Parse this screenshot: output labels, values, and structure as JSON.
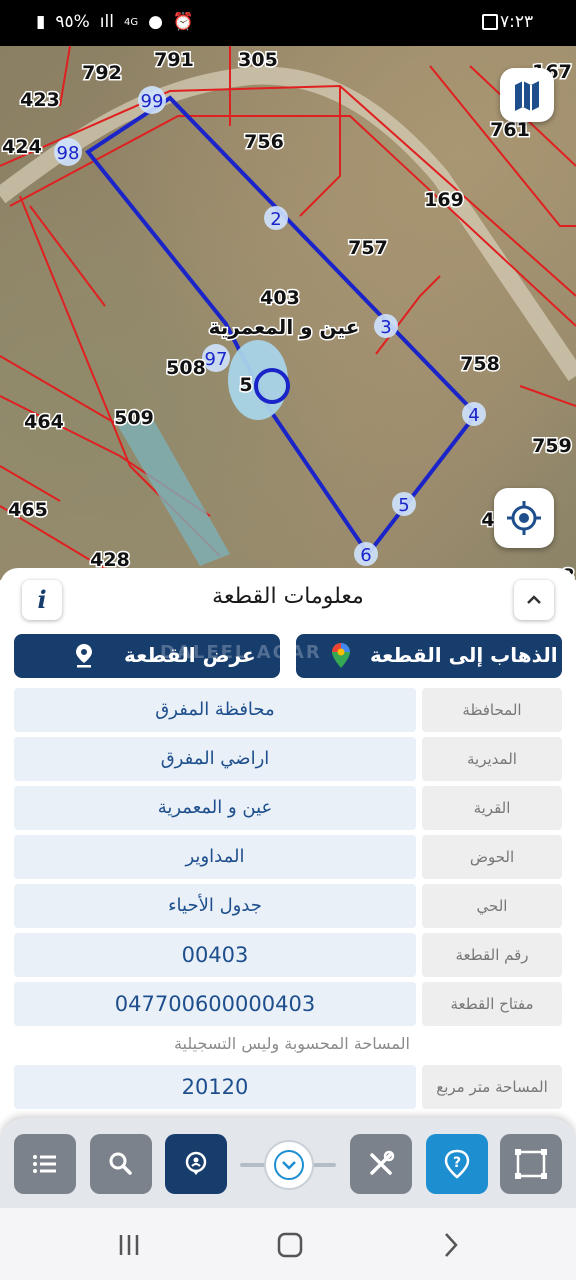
{
  "status_bar": {
    "time": "٧:٢٣",
    "battery": "٩٥%",
    "network": "4G",
    "icons": [
      "battery-icon",
      "signal-icon",
      "network-4g-icon",
      "location-icon",
      "alarm-icon",
      "notification-square-icon"
    ]
  },
  "map": {
    "parcel_numbers": [
      "791",
      "305",
      "792",
      "167",
      "423",
      "99",
      "424",
      "98",
      "756",
      "761",
      "169",
      "757",
      "403",
      "758",
      "508",
      "509",
      "464",
      "759",
      "465",
      "428",
      "4",
      "8",
      "5",
      "6"
    ],
    "vertex_labels": [
      "99",
      "98",
      "2",
      "3",
      "4",
      "5",
      "6",
      "97"
    ],
    "village_label": "عين و المعمرية",
    "parcel_outline_color": "#1a24c8",
    "boundary_color": "#e02020"
  },
  "panel": {
    "title": "معلومات القطعة",
    "go_button": "الذهاب إلى القطعة",
    "show_button": "عرض القطعة",
    "watermark": "DALEEL AQAR",
    "rows": [
      {
        "label": "المحافظة",
        "value": "محافظة المفرق"
      },
      {
        "label": "المديرية",
        "value": "اراضي المفرق"
      },
      {
        "label": "القرية",
        "value": "عين و المعمرية"
      },
      {
        "label": "الحوض",
        "value": "المداوير"
      },
      {
        "label": "الحي",
        "value": "جدول الأحياء"
      },
      {
        "label": "رقم القطعة",
        "value": "00403"
      },
      {
        "label": "مفتاح القطعة",
        "value": "047700600000403"
      }
    ],
    "note": "المساحة المحسوبة وليس التسجيلية",
    "area": {
      "label": "المساحة متر مربع",
      "value": "20120"
    }
  },
  "toolbar": {
    "icons": [
      "list-icon",
      "search-icon",
      "location-pin-icon",
      "chevron-down-icon",
      "tools-icon",
      "help-icon",
      "polygon-select-icon"
    ]
  }
}
